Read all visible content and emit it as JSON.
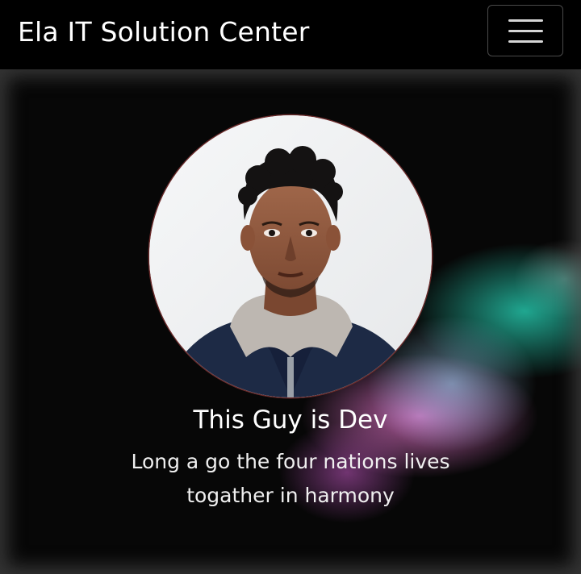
{
  "navbar": {
    "brand": "Ela IT Solution Center",
    "menu_icon": "hamburger-menu-icon"
  },
  "hero": {
    "avatar_icon": "profile-photo",
    "title": "This Guy is Dev",
    "subtitle": "Long a go the four nations lives togather in harmony"
  },
  "colors": {
    "navbar_background": "#000000",
    "text": "#ffffff",
    "avatar_border": "#6a2b2b"
  }
}
